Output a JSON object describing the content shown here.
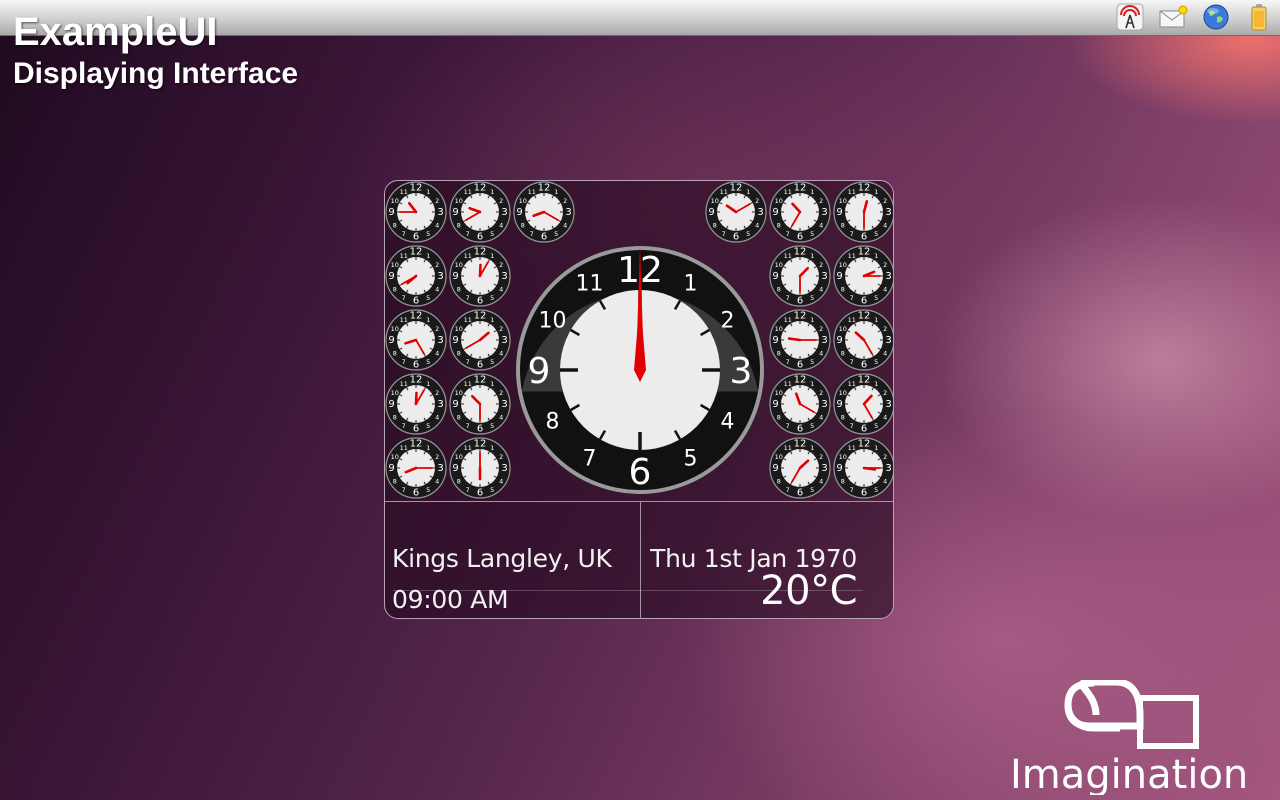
{
  "app": {
    "title": "ExampleUI",
    "subtitle": "Displaying Interface"
  },
  "tray": [
    {
      "icon": "signal-tower-icon"
    },
    {
      "icon": "mail-icon"
    },
    {
      "icon": "globe-icon"
    },
    {
      "icon": "battery-icon"
    }
  ],
  "main_clock": {
    "numerals": [
      "12",
      "1",
      "2",
      "3",
      "4",
      "5",
      "6",
      "7",
      "8",
      "9",
      "10",
      "11"
    ],
    "hour": 9,
    "minute": 0,
    "hand_color": "#e00000"
  },
  "mini_clocks": {
    "numerals": [
      "12",
      "1",
      "2",
      "3",
      "4",
      "5",
      "6",
      "7",
      "8",
      "9",
      "10",
      "11"
    ],
    "hand_color": "#e00000",
    "left": [
      [
        [
          10,
          45
        ],
        [
          9,
          40
        ],
        [
          8,
          20
        ]
      ],
      [
        [
          7,
          40
        ],
        [
          12,
          5
        ]
      ],
      [
        [
          8,
          25
        ],
        [
          1,
          40
        ]
      ],
      [
        [
          12,
          5
        ],
        [
          10,
          30
        ]
      ],
      [
        [
          8,
          15
        ],
        [
          6,
          0
        ]
      ]
    ],
    "right": [
      [
        [
          10,
          10
        ],
        [
          10,
          35
        ],
        [
          12,
          30
        ]
      ],
      [
        [
          1,
          30
        ],
        [
          2,
          15
        ]
      ],
      [
        [
          9,
          15
        ],
        [
          10,
          25
        ]
      ],
      [
        [
          11,
          20
        ],
        [
          1,
          25
        ]
      ],
      [
        [
          1,
          35
        ],
        [
          3,
          15
        ]
      ]
    ]
  },
  "weather": {
    "city": "Kings Langley, UK",
    "time": "09:00 AM",
    "date": "Thu 1st Jan 1970",
    "temperature": "20°C"
  },
  "logo": {
    "text": "Imagination"
  },
  "colors": {
    "hand": "#e00000",
    "dial_face": "#ececec",
    "bezel_dark": "#111111"
  }
}
